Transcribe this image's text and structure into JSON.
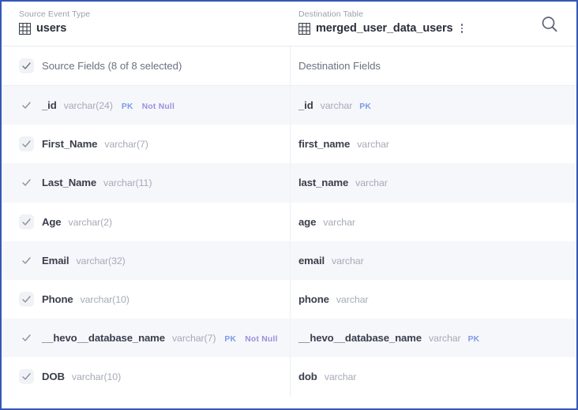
{
  "panel": {
    "accent_border_color": "#3558b5",
    "stripe_color": "#f6f7fb"
  },
  "header": {
    "source": {
      "caption": "Source Event Type",
      "icon": "table-grid-icon",
      "title": "users"
    },
    "destination": {
      "caption": "Destination Table",
      "icon": "table-grid-icon",
      "title": "merged_user_data_users",
      "menu_icon": "kebab-menu-icon"
    },
    "search_icon": "search-icon"
  },
  "fields_header": {
    "source_label": "Source Fields (8 of 8 selected)",
    "destination_label": "Destination Fields",
    "select_all_checked": true
  },
  "badges": {
    "pk": "PK",
    "not_null": "Not Null",
    "pk_color": "#7b9ae8",
    "not_null_color": "#9a8ee0"
  },
  "rows": [
    {
      "checked": true,
      "source": {
        "name": "_id",
        "type": "varchar(24)",
        "pk": "PK",
        "not_null": "Not Null"
      },
      "destination": {
        "name": "_id",
        "type": "varchar",
        "pk": "PK",
        "not_null": ""
      }
    },
    {
      "checked": true,
      "source": {
        "name": "First_Name",
        "type": "varchar(7)",
        "pk": "",
        "not_null": ""
      },
      "destination": {
        "name": "first_name",
        "type": "varchar",
        "pk": "",
        "not_null": ""
      }
    },
    {
      "checked": true,
      "source": {
        "name": "Last_Name",
        "type": "varchar(11)",
        "pk": "",
        "not_null": ""
      },
      "destination": {
        "name": "last_name",
        "type": "varchar",
        "pk": "",
        "not_null": ""
      }
    },
    {
      "checked": true,
      "source": {
        "name": "Age",
        "type": "varchar(2)",
        "pk": "",
        "not_null": ""
      },
      "destination": {
        "name": "age",
        "type": "varchar",
        "pk": "",
        "not_null": ""
      }
    },
    {
      "checked": true,
      "source": {
        "name": "Email",
        "type": "varchar(32)",
        "pk": "",
        "not_null": ""
      },
      "destination": {
        "name": "email",
        "type": "varchar",
        "pk": "",
        "not_null": ""
      }
    },
    {
      "checked": true,
      "source": {
        "name": "Phone",
        "type": "varchar(10)",
        "pk": "",
        "not_null": ""
      },
      "destination": {
        "name": "phone",
        "type": "varchar",
        "pk": "",
        "not_null": ""
      }
    },
    {
      "checked": true,
      "source": {
        "name": "__hevo__database_name",
        "type": "varchar(7)",
        "pk": "PK",
        "not_null": "Not Null"
      },
      "destination": {
        "name": "__hevo__database_name",
        "type": "varchar",
        "pk": "PK",
        "not_null": ""
      }
    },
    {
      "checked": true,
      "source": {
        "name": "DOB",
        "type": "varchar(10)",
        "pk": "",
        "not_null": ""
      },
      "destination": {
        "name": "dob",
        "type": "varchar",
        "pk": "",
        "not_null": ""
      }
    }
  ]
}
